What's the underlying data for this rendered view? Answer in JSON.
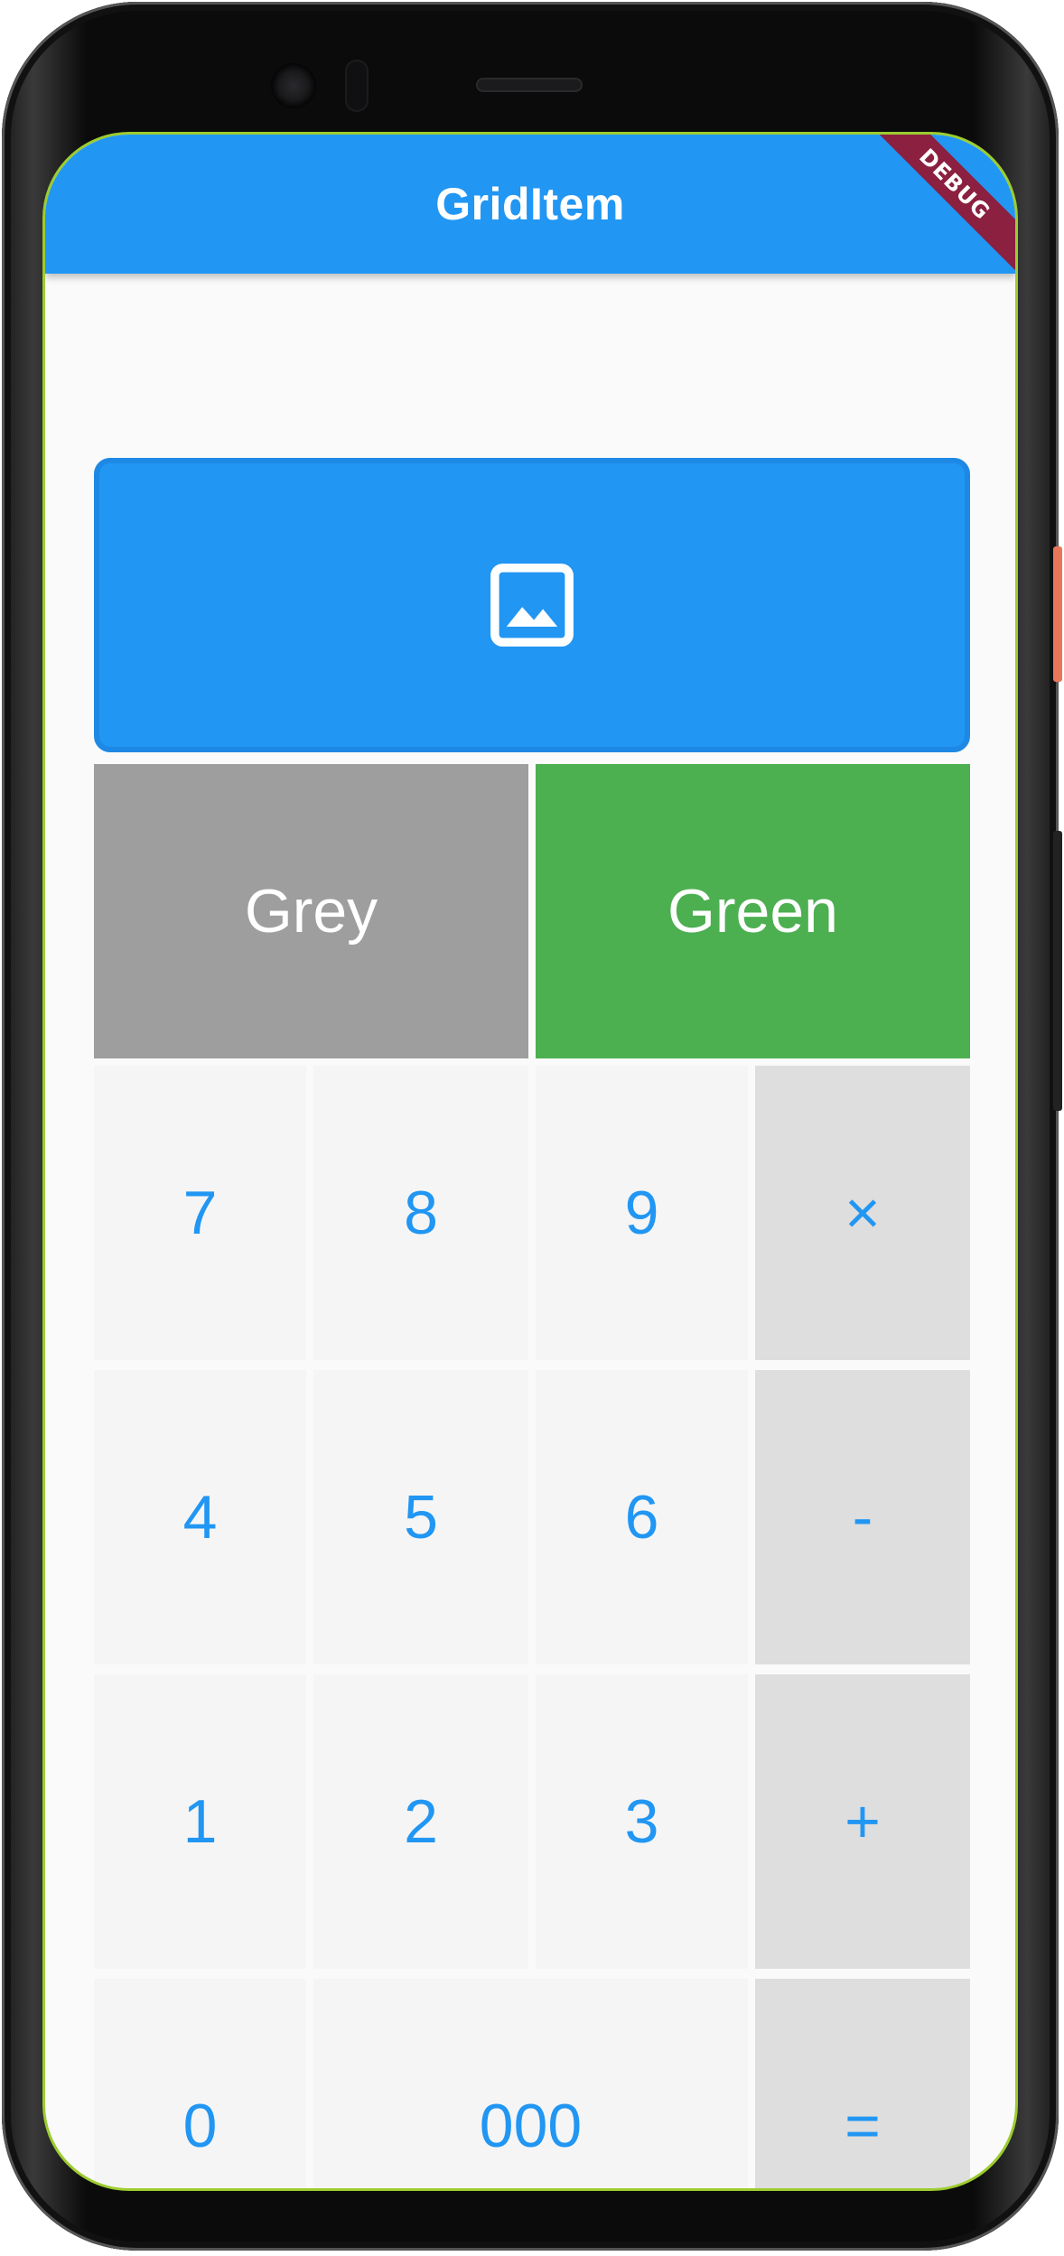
{
  "appbar": {
    "title": "GridItem",
    "debug_label": "DEBUG"
  },
  "image_tile": {
    "icon": "image-icon"
  },
  "color_tiles": {
    "grey_label": "Grey",
    "green_label": "Green"
  },
  "keypad": {
    "row1": [
      "7",
      "8",
      "9",
      "×"
    ],
    "row2": [
      "4",
      "5",
      "6",
      "-"
    ],
    "row3": [
      "1",
      "2",
      "3",
      "+"
    ],
    "row4": [
      "0",
      "000",
      "="
    ]
  },
  "colors": {
    "appbar": "#2196f3",
    "grey_tile": "#9e9e9e",
    "green_tile": "#4caf50",
    "key_text": "#2196f3",
    "operator_key": "#dedede",
    "debug_banner": "#8b2040"
  }
}
